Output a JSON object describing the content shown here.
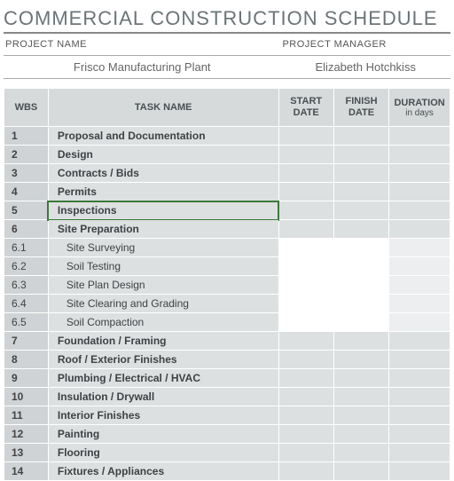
{
  "title": "COMMERCIAL CONSTRUCTION SCHEDULE",
  "meta": {
    "projectNameLabel": "PROJECT NAME",
    "projectName": "Frisco Manufacturing Plant",
    "projectManagerLabel": "PROJECT MANAGER",
    "projectManager": "Elizabeth Hotchkiss"
  },
  "headers": {
    "wbs": "WBS",
    "task": "TASK NAME",
    "start": "START DATE",
    "finish": "FINISH DATE",
    "duration": "DURATION",
    "durationSub": "in days"
  },
  "rows": [
    {
      "wbs": "1",
      "task": "Proposal and Documentation",
      "type": "parent"
    },
    {
      "wbs": "2",
      "task": "Design",
      "type": "parent"
    },
    {
      "wbs": "3",
      "task": "Contracts / Bids",
      "type": "parent"
    },
    {
      "wbs": "4",
      "task": "Permits",
      "type": "parent"
    },
    {
      "wbs": "5",
      "task": "Inspections",
      "type": "parent",
      "selected": true
    },
    {
      "wbs": "6",
      "task": "Site Preparation",
      "type": "parent"
    },
    {
      "wbs": "6.1",
      "task": "Site Surveying",
      "type": "child"
    },
    {
      "wbs": "6.2",
      "task": "Soil Testing",
      "type": "child"
    },
    {
      "wbs": "6.3",
      "task": "Site Plan Design",
      "type": "child"
    },
    {
      "wbs": "6.4",
      "task": "Site Clearing and Grading",
      "type": "child"
    },
    {
      "wbs": "6.5",
      "task": "Soil Compaction",
      "type": "child"
    },
    {
      "wbs": "7",
      "task": "Foundation / Framing",
      "type": "parent"
    },
    {
      "wbs": "8",
      "task": "Roof / Exterior Finishes",
      "type": "parent"
    },
    {
      "wbs": "9",
      "task": "Plumbing / Electrical / HVAC",
      "type": "parent"
    },
    {
      "wbs": "10",
      "task": "Insulation / Drywall",
      "type": "parent"
    },
    {
      "wbs": "11",
      "task": "Interior Finishes",
      "type": "parent"
    },
    {
      "wbs": "12",
      "task": "Painting",
      "type": "parent"
    },
    {
      "wbs": "13",
      "task": "Flooring",
      "type": "parent"
    },
    {
      "wbs": "14",
      "task": "Fixtures / Appliances",
      "type": "parent"
    }
  ]
}
